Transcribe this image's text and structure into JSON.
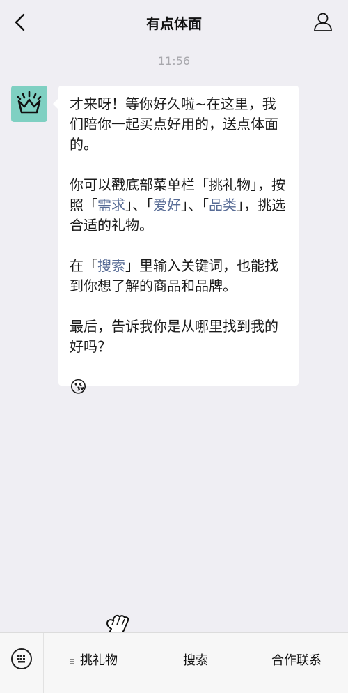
{
  "header": {
    "title": "有点体面",
    "back_icon": "chevron-left-icon",
    "profile_icon": "person-icon"
  },
  "chat": {
    "time": "11:56",
    "avatar_icon": "crown-logo-icon",
    "avatar_color": "#7fd0c2",
    "message": {
      "p1": "才来呀！等你好久啦~在这里，我们陪你一起买点好用的，送点体面的。",
      "p2_a": "你可以戳底部菜单栏「挑礼物」，按照「",
      "p2_kw1": "需求",
      "p2_b": "」、「",
      "p2_kw2": "爱好",
      "p2_c": "」、「",
      "p2_kw3": "品类",
      "p2_d": "」，挑选合适的礼物。",
      "p3_a": "在「",
      "p3_kw": "搜索",
      "p3_b": "」里输入关键词，也能找到你想了解的商品和品牌。",
      "p4": "最后，告诉我你是从哪里找到我的好吗？",
      "emoji": "😘"
    },
    "keyword_color": "#576b95"
  },
  "bottom_menu": {
    "keyboard_icon": "keyboard-icon",
    "items": [
      {
        "label": "挑礼物",
        "icon": "menu-lines-icon"
      },
      {
        "label": "搜索"
      },
      {
        "label": "合作联系"
      }
    ],
    "pointer_icon": "pointing-hand-icon"
  }
}
